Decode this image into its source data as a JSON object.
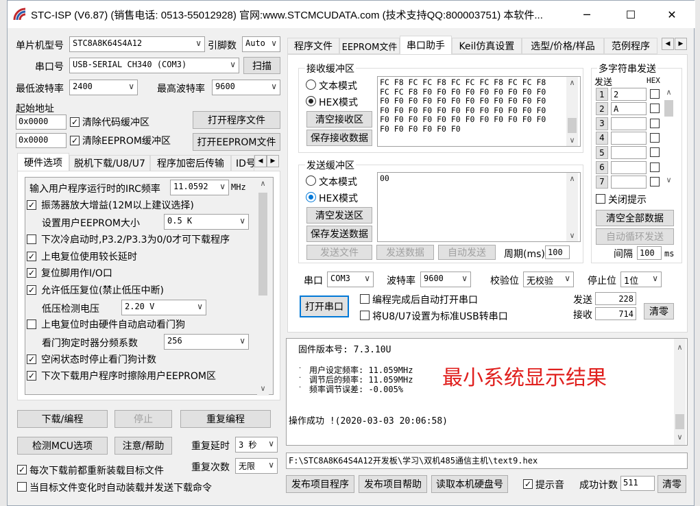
{
  "window": {
    "title": "STC-ISP (V6.87) (销售电话: 0513-55012928) 官网:www.STCMCUDATA.com  (技术支持QQ:800003751) 本软件...",
    "minimize": "─",
    "maximize": "☐",
    "close": "✕"
  },
  "left": {
    "mcu_label": "单片机型号",
    "mcu_value": "STC8A8K64S4A12",
    "pins_label": "引脚数",
    "pins_value": "Auto",
    "port_label": "串口号",
    "port_value": "USB-SERIAL CH340 (COM3)",
    "scan_button": "扫描",
    "min_baud_label": "最低波特率",
    "min_baud_value": "2400",
    "max_baud_label": "最高波特率",
    "max_baud_value": "9600",
    "start_addr_label": "起始地址",
    "addr1": "0x0000",
    "clear_code_label": "清除代码缓冲区",
    "open_prog_button": "打开程序文件",
    "addr2": "0x0000",
    "clear_eeprom_label": "清除EEPROM缓冲区",
    "open_eeprom_button": "打开EEPROM文件",
    "tabs": [
      "硬件选项",
      "脱机下载/U8/U7",
      "程序加密后传输",
      "ID号"
    ],
    "hw": {
      "irc_label": "输入用户程序运行时的IRC频率",
      "irc_value": "11.0592",
      "irc_unit": "MHz",
      "opt1": "振荡器放大增益(12M以上建议选择)",
      "eeprom_size_label": "设置用户EEPROM大小",
      "eeprom_size_value": "0.5 K",
      "opt2": "下次冷启动时,P3.2/P3.3为0/0才可下载程序",
      "opt3": "上电复位使用较长延时",
      "opt4": "复位脚用作I/O口",
      "opt5": "允许低压复位(禁止低压中断)",
      "lvd_label": "低压检测电压",
      "lvd_value": "2.20 V",
      "opt6": "上电复位时由硬件自动启动看门狗",
      "wdt_label": "看门狗定时器分频系数",
      "wdt_value": "256",
      "opt7": "空闲状态时停止看门狗计数",
      "opt8": "下次下载用户程序时擦除用户EEPROM区"
    },
    "download_button": "下载/编程",
    "stop_button": "停止",
    "reprog_button": "重复编程",
    "check_mcu_button": "检测MCU选项",
    "help_button": "注意/帮助",
    "repeat_delay_label": "重复延时",
    "repeat_delay_value": "3 秒",
    "repeat_count_label": "重复次数",
    "repeat_count_value": "无限",
    "reload_label": "每次下载前都重新装载目标文件",
    "auto_label": "当目标文件变化时自动装载并发送下载命令"
  },
  "right": {
    "tabs": [
      "程序文件",
      "EEPROM文件",
      "串口助手",
      "Keil仿真设置",
      "选型/价格/样品",
      "范例程序"
    ],
    "recv_group": "接收缓冲区",
    "text_mode": "文本模式",
    "hex_mode": "HEX模式",
    "clear_recv": "清空接收区",
    "save_recv": "保存接收数据",
    "recv_content": "FC F8 FC FC F8 FC FC FC F8 FC FC F8\nFC FC F8 F0 F0 F0 F0 F0 F0 F0 F0 F0\nF0 F0 F0 F0 F0 F0 F0 F0 F0 F0 F0 F0\nF0 F0 F0 F0 F0 F0 F0 F0 F0 F0 F0 F0\nF0 F0 F0 F0 F0 F0 F0 F0 F0 F0 F0 F0\nF0 F0 F0 F0 F0 F0",
    "send_group": "发送缓冲区",
    "clear_send": "清空发送区",
    "save_send": "保存发送数据",
    "send_content": "00",
    "send_file": "发送文件",
    "send_data": "发送数据",
    "auto_send": "自动发送",
    "period_label": "周期(ms)",
    "period_value": "100",
    "multi_group": "多字符串发送",
    "send_col": "发送",
    "hex_col": "HEX",
    "multi_rows": [
      {
        "num": "1",
        "val": "2"
      },
      {
        "num": "2",
        "val": "A"
      },
      {
        "num": "3",
        "val": ""
      },
      {
        "num": "4",
        "val": ""
      },
      {
        "num": "5",
        "val": ""
      },
      {
        "num": "6",
        "val": ""
      },
      {
        "num": "7",
        "val": ""
      }
    ],
    "close_hint": "关闭提示",
    "clear_all": "清空全部数据",
    "auto_cycle": "自动循环发送",
    "interval_label": "间隔",
    "interval_value": "100",
    "interval_unit": "ms",
    "com_label": "串口",
    "com_value": "COM3",
    "baud_label": "波特率",
    "baud_value": "9600",
    "parity_label": "校验位",
    "parity_value": "无校验",
    "stop_label": "停止位",
    "stop_value": "1位",
    "open_port": "打开串口",
    "auto_open": "编程完成后自动打开串口",
    "u8_label": "将U8/U7设置为标准USB转串口",
    "send_count_label": "发送",
    "send_count": "228",
    "recv_count_label": "接收",
    "recv_count": "714",
    "clear_count": "清零",
    "log_fw": "固件版本号: 7.3.10U",
    "log_user_freq": "用户设定频率: 11.059MHz",
    "log_adj_freq": "调节后的频率: 11.059MHz",
    "log_err": "频率调节误差: -0.005%",
    "log_note": "最小系统显示结果",
    "log_ok": "操作成功 !(2020-03-03 20:06:58)",
    "path": "F:\\STC8A8K64S4A12开发板\\学习\\双机485通信主机\\text9.hex",
    "publish_prog": "发布项目程序",
    "publish_help": "发布项目帮助",
    "read_disk": "读取本机硬盘号",
    "sound_label": "提示音",
    "success_label": "成功计数",
    "success_value": "511",
    "clear_success": "清零"
  },
  "colors": {
    "accent": "#0078d7",
    "note": "#e0201e"
  }
}
